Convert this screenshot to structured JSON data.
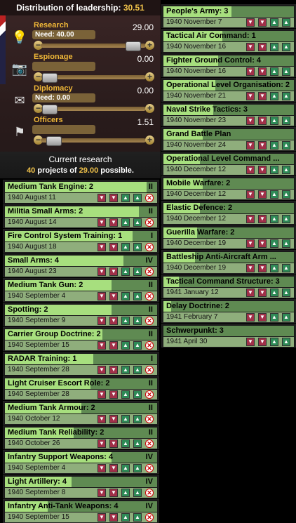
{
  "leadership": {
    "title": "Distribution of leadership:",
    "total": "30.51",
    "categories": [
      {
        "name": "Research",
        "value": "29.00",
        "need": "Need: 40.00",
        "slider": 0.93,
        "icon": "bulb-icon",
        "glyph": "💡"
      },
      {
        "name": "Espionage",
        "value": "0.00",
        "need": "",
        "slider": 0.0,
        "icon": "camera-icon",
        "glyph": "📷"
      },
      {
        "name": "Diplomacy",
        "value": "0.00",
        "need": "Need: 0.00",
        "slider": 0.0,
        "icon": "envelope-icon",
        "glyph": "✉"
      },
      {
        "name": "Officers",
        "value": "1.51",
        "need": "",
        "slider": 0.05,
        "icon": "flag-icon",
        "glyph": "⚑"
      }
    ]
  },
  "current_research": {
    "title": "Current research",
    "count": "40",
    "mid": " projects of ",
    "capacity": "29.00",
    "tail": " possible."
  },
  "left_column": [
    {
      "name": "Medium Tank Engine: 2",
      "date": "1940 August 11",
      "level": "II",
      "progress": 0.93
    },
    {
      "name": "Militia Small Arms: 2",
      "date": "1940 August 14",
      "level": "II",
      "progress": 0.88
    },
    {
      "name": "Fire Control System Training: 1",
      "date": "1940 August 18",
      "level": "I",
      "progress": 0.84
    },
    {
      "name": "Small Arms: 4",
      "date": "1940 August 23",
      "level": "IV",
      "progress": 0.78
    },
    {
      "name": "Medium Tank Gun: 2",
      "date": "1940 September 4",
      "level": "II",
      "progress": 0.7
    },
    {
      "name": "Spotting: 2",
      "date": "1940 September 9",
      "level": "II",
      "progress": 0.7
    },
    {
      "name": "Carrier Group Doctrine: 2",
      "date": "1940 September 15",
      "level": "II",
      "progress": 0.64
    },
    {
      "name": "RADAR Training: 1",
      "date": "1940 September 28",
      "level": "I",
      "progress": 0.58
    },
    {
      "name": "Light Cruiser Escort Role: 2",
      "date": "1940 September 28",
      "level": "II",
      "progress": 0.56
    },
    {
      "name": "Medium Tank Armour: 2",
      "date": "1940 October 12",
      "level": "II",
      "progress": 0.5
    },
    {
      "name": "Medium Tank Reliability: 2",
      "date": "1940 October 26",
      "level": "II",
      "progress": 0.45
    },
    {
      "name": "Infantry Support Weapons: 4",
      "date": "1940 September 4",
      "level": "IV",
      "progress": 0.7
    },
    {
      "name": "Light Artillery: 4",
      "date": "1940 September 8",
      "level": "IV",
      "progress": 0.44
    },
    {
      "name": "Infantry Anti-Tank Weapons: 4",
      "date": "1940 September 15",
      "level": "IV",
      "progress": 0.28
    }
  ],
  "right_column": [
    {
      "name": "People's Army: 3",
      "date": "1940 November 7",
      "level": "",
      "progress": 0.52
    },
    {
      "name": "Tactical Air Command: 1",
      "date": "1940 November 16",
      "level": "",
      "progress": 0.45
    },
    {
      "name": "Fighter Ground Control: 4",
      "date": "1940 November 16",
      "level": "",
      "progress": 0.42
    },
    {
      "name": "Operational Level Organisation: 2",
      "date": "1940 November 21",
      "level": "",
      "progress": 0.4
    },
    {
      "name": "Naval Strike Tactics: 3",
      "date": "1940 November 23",
      "level": "",
      "progress": 0.38
    },
    {
      "name": "Grand Battle Plan",
      "date": "1940 November 24",
      "level": "",
      "progress": 0.3
    },
    {
      "name": "Operational Level Command ...",
      "date": "1940 December 12",
      "level": "",
      "progress": 0.28
    },
    {
      "name": "Mobile Warfare: 2",
      "date": "1940 December 12",
      "level": "",
      "progress": 0.3
    },
    {
      "name": "Elastic Defence: 2",
      "date": "1940 December 12",
      "level": "",
      "progress": 0.28
    },
    {
      "name": "Guerilla Warfare: 2",
      "date": "1940 December 19",
      "level": "",
      "progress": 0.26
    },
    {
      "name": "Battleship Anti-Aircraft Arm ...",
      "date": "1940 December 19",
      "level": "",
      "progress": 0.24
    },
    {
      "name": "Tactical Command Structure: 3",
      "date": "1941 January 12",
      "level": "",
      "progress": 0.12
    },
    {
      "name": "Delay Doctrine: 2",
      "date": "1941 February 7",
      "level": "",
      "progress": 0.06
    },
    {
      "name": "Schwerpunkt: 3",
      "date": "1941 April 30",
      "level": "",
      "progress": 0.0
    }
  ],
  "icons": {
    "down": "▼",
    "up": "▲",
    "top": "⏫",
    "remove": "✕"
  }
}
